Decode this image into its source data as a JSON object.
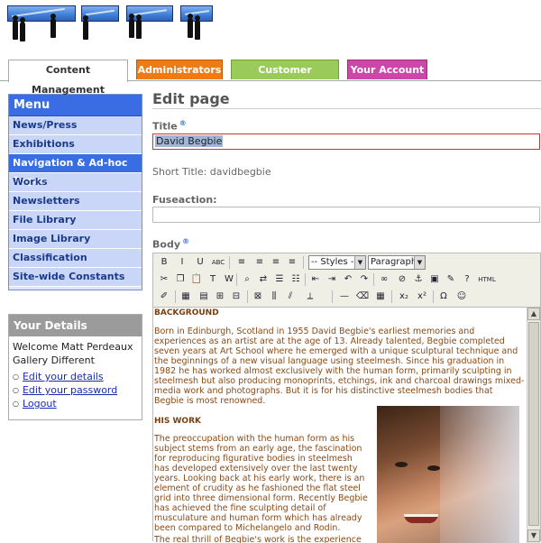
{
  "tabs": [
    {
      "label": "Content Management",
      "color": "#ffffff",
      "text": "#333333",
      "active": true
    },
    {
      "label": "Administrators",
      "color": "#f07a14",
      "text": "#ffffff",
      "active": false
    },
    {
      "label": "Customer Relations",
      "color": "#9acb5a",
      "text": "#ffffff",
      "active": false
    },
    {
      "label": "Your Account",
      "color": "#cc48a8",
      "text": "#ffffff",
      "active": false
    }
  ],
  "menu": {
    "title": "Menu",
    "items": [
      {
        "label": "News/Press",
        "selected": false
      },
      {
        "label": "Exhibitions",
        "selected": false
      },
      {
        "label": "Navigation & Ad-hoc Pages",
        "selected": true
      },
      {
        "label": "Works",
        "selected": false
      },
      {
        "label": "Newsletters",
        "selected": false
      },
      {
        "label": "File Library",
        "selected": false
      },
      {
        "label": "Image Library",
        "selected": false
      },
      {
        "label": "Classification",
        "selected": false
      },
      {
        "label": "Site-wide Constants",
        "selected": false
      }
    ]
  },
  "details": {
    "title": "Your Details",
    "welcome": "Welcome Matt Perdeaux",
    "company": "Gallery Different",
    "links": [
      "Edit your details",
      "Edit your password",
      "Logout"
    ]
  },
  "form": {
    "page_title": "Edit page",
    "title_label": "Title",
    "title_value": "David Begbie",
    "short_title": "Short Title: davidbegbie",
    "fuseaction_label": "Fuseaction:",
    "fuseaction_value": "",
    "body_label": "Body",
    "help_glyph": "®"
  },
  "editor": {
    "styles_select": "-- Styles --",
    "format_select": "Paragraph",
    "toolbar_row1": [
      {
        "icon": "bold-icon",
        "glyph": "B"
      },
      {
        "icon": "italic-icon",
        "glyph": "I"
      },
      {
        "icon": "underline-icon",
        "glyph": "U"
      },
      {
        "icon": "strikethrough-icon",
        "glyph": "ABC"
      },
      {
        "icon": "align-left-icon",
        "glyph": "≡"
      },
      {
        "icon": "align-center-icon",
        "glyph": "≡"
      },
      {
        "icon": "align-right-icon",
        "glyph": "≡"
      },
      {
        "icon": "align-justify-icon",
        "glyph": "≡"
      }
    ],
    "toolbar_row2": [
      {
        "icon": "cut-icon",
        "glyph": "✂"
      },
      {
        "icon": "copy-icon",
        "glyph": "❐"
      },
      {
        "icon": "paste-icon",
        "glyph": "📋"
      },
      {
        "icon": "paste-text-icon",
        "glyph": "T"
      },
      {
        "icon": "paste-word-icon",
        "glyph": "W"
      },
      {
        "icon": "find-icon",
        "glyph": "⌕"
      },
      {
        "icon": "replace-icon",
        "glyph": "⇄"
      },
      {
        "icon": "bullet-list-icon",
        "glyph": "☰"
      },
      {
        "icon": "numbered-list-icon",
        "glyph": "☷"
      },
      {
        "icon": "outdent-icon",
        "glyph": "⇤"
      },
      {
        "icon": "indent-icon",
        "glyph": "⇥"
      },
      {
        "icon": "undo-icon",
        "glyph": "↶"
      },
      {
        "icon": "redo-icon",
        "glyph": "↷"
      },
      {
        "icon": "link-icon",
        "glyph": "∞"
      },
      {
        "icon": "unlink-icon",
        "glyph": "⊘"
      },
      {
        "icon": "anchor-icon",
        "glyph": "⚓"
      },
      {
        "icon": "image-icon",
        "glyph": "▣"
      },
      {
        "icon": "cleanup-icon",
        "glyph": "✎"
      },
      {
        "icon": "help-icon",
        "glyph": "?"
      },
      {
        "icon": "html-icon",
        "glyph": "HTML"
      }
    ],
    "toolbar_row3": [
      {
        "icon": "edit-icon",
        "glyph": "✐"
      },
      {
        "icon": "table-icon",
        "glyph": "▦"
      },
      {
        "icon": "row-props-icon",
        "glyph": "▤"
      },
      {
        "icon": "insert-row-before-icon",
        "glyph": "⊞"
      },
      {
        "icon": "insert-row-after-icon",
        "glyph": "⊟"
      },
      {
        "icon": "delete-row-icon",
        "glyph": "⊠"
      },
      {
        "icon": "insert-col-before-icon",
        "glyph": "⫼"
      },
      {
        "icon": "insert-col-after-icon",
        "glyph": "⫽"
      },
      {
        "icon": "delete-col-icon",
        "glyph": "⟂"
      },
      {
        "icon": "horizontal-rule-icon",
        "glyph": "—"
      },
      {
        "icon": "remove-format-icon",
        "glyph": "⌫"
      },
      {
        "icon": "visual-aid-icon",
        "glyph": "▦"
      },
      {
        "icon": "subscript-icon",
        "glyph": "x₂"
      },
      {
        "icon": "superscript-icon",
        "glyph": "x²"
      },
      {
        "icon": "special-char-icon",
        "glyph": "Ω"
      },
      {
        "icon": "emoticon-icon",
        "glyph": "☺"
      }
    ]
  },
  "content": {
    "heading1": "BACKGROUND",
    "para1": "Born in Edinburgh, Scotland in 1955 David Begbie's earliest memories and experiences as an artist are at the age of 13. Already talented, Begbie completed seven years at Art School where he emerged with a unique sculptural technique and the beginnings of a new visual language using steelmesh. Since his graduation in 1982 he has worked almost exclusively with the human form, primarily sculpting in steelmesh but also producing monoprints, etchings, ink and charcoal drawings mixed-media work and photographs. But it is for his distinctive steelmesh bodies that Begbie is most renowned.",
    "heading2": "HIS WORK",
    "para2": "The preoccupation with the human form as his subject stems from an early age, the fascination for reproducing figurative bodies in steelmesh has developed extensively over the last twenty years. Looking back at his early work, there is an element of crudity as he fashioned the flat steel grid into three dimensional form. Recently Begbie has achieved the fine sculpting detail of musculature and human form which has already been compared to Michelangelo and Rodin.",
    "para3": "The real thrill of Begbie's work is the experience"
  }
}
